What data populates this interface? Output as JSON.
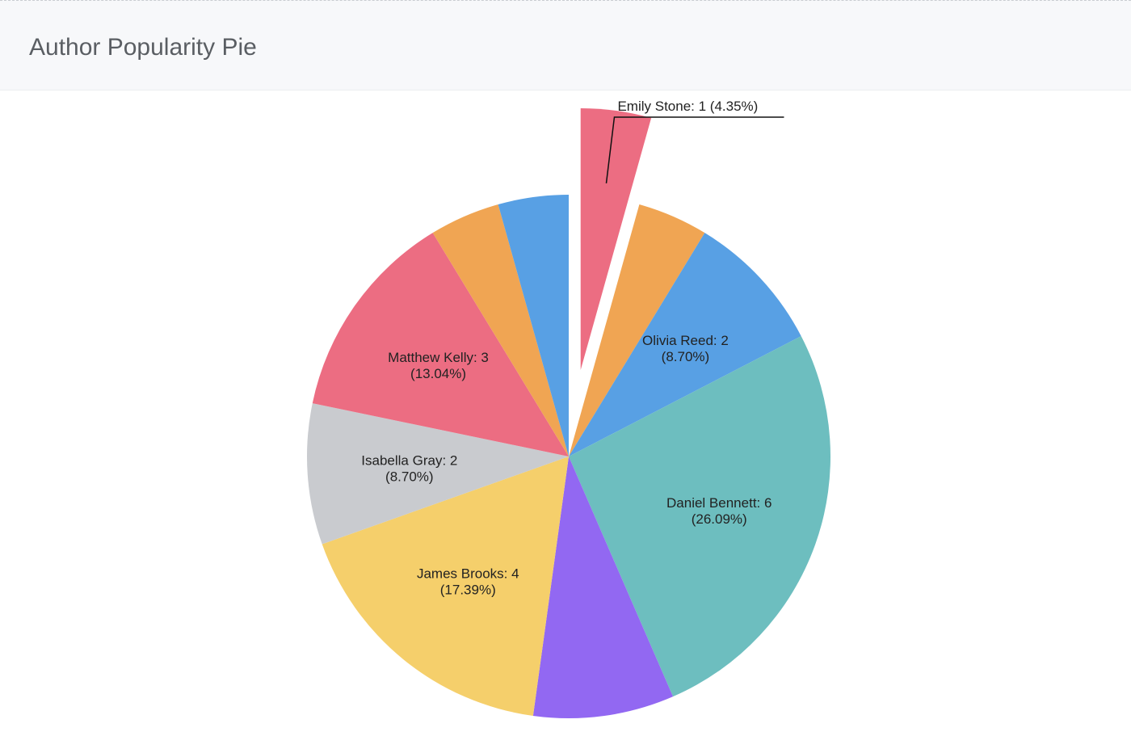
{
  "header": {
    "title": "Author Popularity Pie"
  },
  "chart_data": {
    "type": "pie",
    "title": "Author Popularity Pie",
    "total": 23,
    "start_angle_deg": 0,
    "direction": "clockwise",
    "slices": [
      {
        "name": "Emily Stone",
        "value": 1,
        "percent": "4.35%",
        "label": "Emily Stone: 1",
        "percent_label": "(4.35%)",
        "color": "#ec6d82",
        "exploded": true,
        "label_outside": true
      },
      {
        "name": "",
        "value": 1,
        "percent": "4.35%",
        "label": "",
        "percent_label": "",
        "color": "#f0a553",
        "exploded": false
      },
      {
        "name": "Olivia Reed",
        "value": 2,
        "percent": "8.70%",
        "label": "Olivia Reed: 2",
        "percent_label": "(8.70%)",
        "color": "#58a0e4",
        "exploded": false
      },
      {
        "name": "Daniel Bennett",
        "value": 6,
        "percent": "26.09%",
        "label": "Daniel Bennett: 6",
        "percent_label": "(26.09%)",
        "color": "#6dbebf",
        "exploded": false
      },
      {
        "name": "",
        "value": 2,
        "percent": "8.70%",
        "label": "",
        "percent_label": "",
        "color": "#9268f2",
        "exploded": false
      },
      {
        "name": "James Brooks",
        "value": 4,
        "percent": "17.39%",
        "label": "James Brooks: 4",
        "percent_label": "(17.39%)",
        "color": "#f5cf6b",
        "exploded": false
      },
      {
        "name": "Isabella Gray",
        "value": 2,
        "percent": "8.70%",
        "label": "Isabella Gray: 2",
        "percent_label": "(8.70%)",
        "color": "#c9cbcf",
        "exploded": false
      },
      {
        "name": "Matthew Kelly",
        "value": 3,
        "percent": "13.04%",
        "label": "Matthew Kelly: 3",
        "percent_label": "(13.04%)",
        "color": "#ec6d82",
        "exploded": false
      },
      {
        "name": "",
        "value": 1,
        "percent": "4.35%",
        "label": "",
        "percent_label": "",
        "color": "#f0a553",
        "exploded": false
      },
      {
        "name": "",
        "value": 1,
        "percent": "4.35%",
        "label": "",
        "percent_label": "",
        "color": "#58a0e4",
        "exploded": false
      }
    ]
  }
}
